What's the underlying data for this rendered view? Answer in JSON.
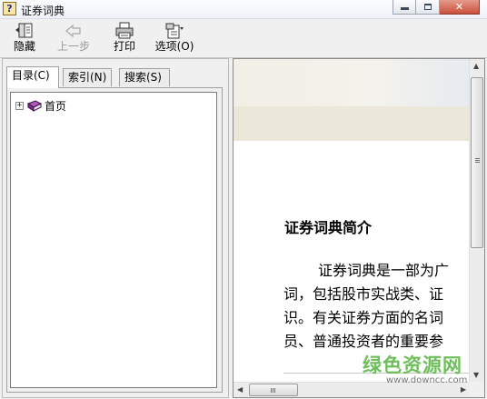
{
  "window": {
    "title": "证券词典",
    "controls": [
      "minimize",
      "maximize",
      "close"
    ]
  },
  "toolbar": {
    "hide_label": "隐藏",
    "back_label": "上一步",
    "print_label": "打印",
    "options_label": "选项(O)"
  },
  "tabs": {
    "contents": "目录(C)",
    "index": "索引(N)",
    "search": "搜索(S)"
  },
  "tree": {
    "items": [
      {
        "label": "首页",
        "expander": "+"
      }
    ]
  },
  "content": {
    "heading": "证券词典简介",
    "lines": [
      "证券词典是一部为广",
      "词，包括股市实战类、证",
      "识。有关证券方面的名词",
      "员、普通投资者的重要参"
    ]
  },
  "watermark": {
    "main": "绿色资源网",
    "sub": "www.downcc.com"
  },
  "colors": {
    "banner": "#ebe7d9",
    "watermark": "#5fb84a",
    "close_button": "#c8503a"
  }
}
